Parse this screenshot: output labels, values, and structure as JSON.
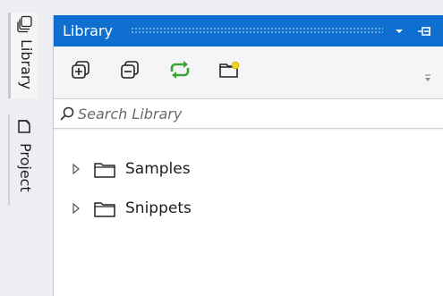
{
  "side_tabs": [
    {
      "label": "Library",
      "icon": "library-icon",
      "active": true
    },
    {
      "label": "Project",
      "icon": "project-icon",
      "active": false
    }
  ],
  "panel": {
    "title": "Library",
    "dropdown_icon": "chevron-down-icon",
    "pin_icon": "pin-icon"
  },
  "toolbar": {
    "buttons": [
      {
        "icon": "expand-all-icon"
      },
      {
        "icon": "collapse-all-icon"
      },
      {
        "icon": "refresh-icon"
      },
      {
        "icon": "new-folder-icon"
      }
    ],
    "overflow_icon": "overflow-icon"
  },
  "search": {
    "placeholder": "Search Library",
    "value": "",
    "icon": "search-icon"
  },
  "tree": {
    "items": [
      {
        "label": "Samples",
        "expanded": false
      },
      {
        "label": "Snippets",
        "expanded": false
      }
    ]
  },
  "colors": {
    "titlebar": "#0e6fd1",
    "refresh_green": "#3aa33a",
    "folder_yellow": "#f2d21a",
    "panel_bg": "#f5f5f7"
  }
}
